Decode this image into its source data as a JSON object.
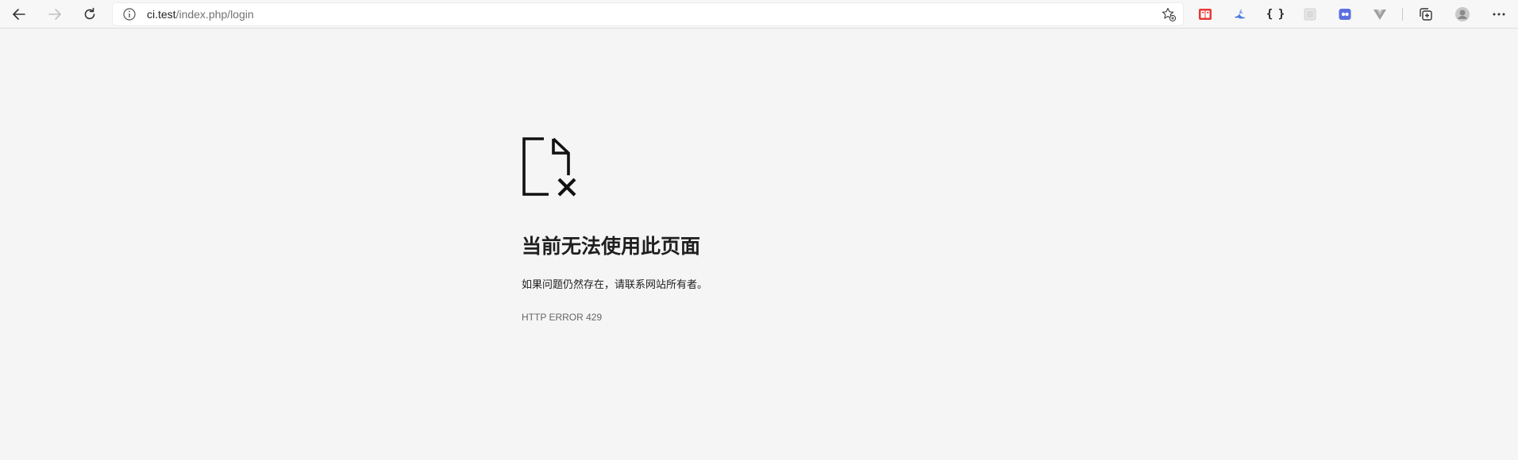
{
  "browser": {
    "url_host": "ci.test",
    "url_path": "/index.php/login",
    "extensions": [
      {
        "name": "fehelper-extension-icon",
        "color": "#e53935"
      },
      {
        "name": "bird-extension-icon",
        "color": "#4a7be0"
      },
      {
        "name": "json-braces-extension-icon",
        "label": "{ }"
      },
      {
        "name": "grey-square-extension-icon",
        "color": "#d8d8d8"
      },
      {
        "name": "purple-extension-icon",
        "color": "#5b6ee1"
      },
      {
        "name": "vue-devtools-extension-icon",
        "color": "#9e9e9e"
      }
    ]
  },
  "error": {
    "title": "当前无法使用此页面",
    "message": "如果问题仍然存在，请联系网站所有者。",
    "code": "HTTP ERROR 429"
  }
}
